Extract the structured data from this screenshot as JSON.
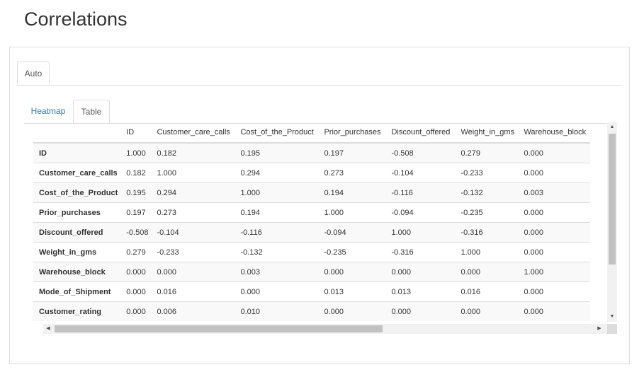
{
  "page": {
    "title": "Correlations"
  },
  "outer_tabs": [
    {
      "label": "Auto",
      "active": true
    }
  ],
  "inner_tabs": [
    {
      "label": "Heatmap",
      "active": false
    },
    {
      "label": "Table",
      "active": true
    }
  ],
  "table": {
    "columns": [
      "",
      "ID",
      "Customer_care_calls",
      "Cost_of_the_Product",
      "Prior_purchases",
      "Discount_offered",
      "Weight_in_gms",
      "Warehouse_block"
    ],
    "rows": [
      {
        "label": "ID",
        "values": [
          "1.000",
          "0.182",
          "0.195",
          "0.197",
          "-0.508",
          "0.279",
          "0.000"
        ]
      },
      {
        "label": "Customer_care_calls",
        "values": [
          "0.182",
          "1.000",
          "0.294",
          "0.273",
          "-0.104",
          "-0.233",
          "0.000"
        ]
      },
      {
        "label": "Cost_of_the_Product",
        "values": [
          "0.195",
          "0.294",
          "1.000",
          "0.194",
          "-0.116",
          "-0.132",
          "0.003"
        ]
      },
      {
        "label": "Prior_purchases",
        "values": [
          "0.197",
          "0.273",
          "0.194",
          "1.000",
          "-0.094",
          "-0.235",
          "0.000"
        ]
      },
      {
        "label": "Discount_offered",
        "values": [
          "-0.508",
          "-0.104",
          "-0.116",
          "-0.094",
          "1.000",
          "-0.316",
          "0.000"
        ]
      },
      {
        "label": "Weight_in_gms",
        "values": [
          "0.279",
          "-0.233",
          "-0.132",
          "-0.235",
          "-0.316",
          "1.000",
          "0.000"
        ]
      },
      {
        "label": "Warehouse_block",
        "values": [
          "0.000",
          "0.000",
          "0.003",
          "0.000",
          "0.000",
          "0.000",
          "1.000"
        ]
      },
      {
        "label": "Mode_of_Shipment",
        "values": [
          "0.000",
          "0.016",
          "0.000",
          "0.013",
          "0.013",
          "0.016",
          "0.000"
        ]
      },
      {
        "label": "Customer_rating",
        "values": [
          "0.000",
          "0.006",
          "0.010",
          "0.000",
          "0.000",
          "0.000",
          "0.000"
        ]
      }
    ]
  },
  "icons": {
    "scroll_up": "▲",
    "scroll_down": "▼",
    "scroll_left": "◀",
    "scroll_right": "▶"
  },
  "colors": {
    "link": "#337ab7",
    "border": "#dddddd",
    "stripe": "#f9f9f9"
  }
}
